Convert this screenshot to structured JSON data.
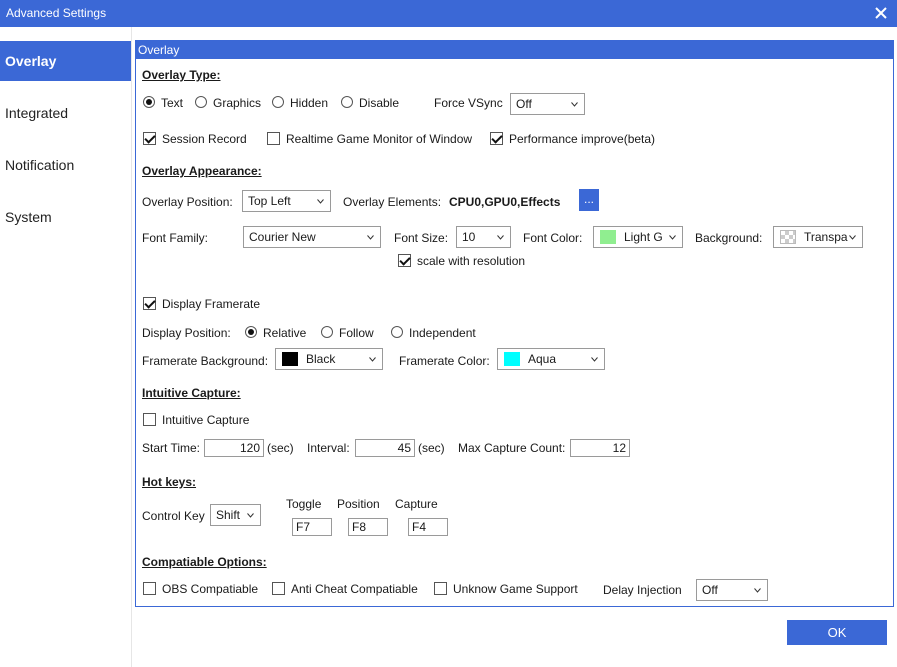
{
  "window": {
    "title": "Advanced Settings"
  },
  "sidebar": {
    "items": [
      {
        "label": "Overlay",
        "active": true
      },
      {
        "label": "Integrated"
      },
      {
        "label": "Notification"
      },
      {
        "label": "System"
      }
    ]
  },
  "panel": {
    "header": "Overlay"
  },
  "overlay_type": {
    "title": "Overlay Type:",
    "options": [
      "Text",
      "Graphics",
      "Hidden",
      "Disable"
    ],
    "selected": "Text",
    "force_vsync_label": "Force VSync",
    "force_vsync_value": "Off"
  },
  "options_row": {
    "session_record": {
      "label": "Session Record",
      "checked": true
    },
    "realtime_monitor": {
      "label": "Realtime Game Monitor of Window",
      "checked": false
    },
    "performance_improve": {
      "label": "Performance improve(beta)",
      "checked": true
    }
  },
  "appearance": {
    "title": "Overlay Appearance:",
    "position_label": "Overlay Position:",
    "position_value": "Top Left",
    "elements_label": "Overlay Elements:",
    "elements_value": "CPU0,GPU0,Effects",
    "elements_button": "...",
    "font_family_label": "Font Family:",
    "font_family_value": "Courier New",
    "font_size_label": "Font Size:",
    "font_size_value": "10",
    "font_color_label": "Font Color:",
    "font_color_value": "Light G",
    "font_color_swatch": "#90ee90",
    "background_label": "Background:",
    "background_value": "Transpa",
    "scale_label": "scale with resolution",
    "scale_checked": true
  },
  "framerate": {
    "display_label": "Display Framerate",
    "display_checked": true,
    "position_label": "Display Position:",
    "position_options": [
      "Relative",
      "Follow",
      "Independent"
    ],
    "position_selected": "Relative",
    "bg_label": "Framerate Background:",
    "bg_value": "Black",
    "bg_swatch": "#000000",
    "color_label": "Framerate Color:",
    "color_value": "Aqua",
    "color_swatch": "#00ffff"
  },
  "capture": {
    "title": "Intuitive Capture:",
    "enable_label": "Intuitive Capture",
    "enable_checked": false,
    "start_label": "Start Time:",
    "start_value": "120",
    "start_unit": "(sec)",
    "interval_label": "Interval:",
    "interval_value": "45",
    "interval_unit": "(sec)",
    "max_label": "Max Capture Count:",
    "max_value": "12"
  },
  "hotkeys": {
    "title": "Hot keys:",
    "control_label": "Control Key",
    "control_value": "Shift",
    "toggle_label": "Toggle",
    "toggle_value": "F7",
    "position_label": "Position",
    "position_value": "F8",
    "capture_label": "Capture",
    "capture_value": "F4"
  },
  "compat": {
    "title": "Compatiable Options:",
    "obs": {
      "label": "OBS Compatiable",
      "checked": false
    },
    "anticheat": {
      "label": "Anti Cheat Compatiable",
      "checked": false
    },
    "unknown": {
      "label": "Unknow Game Support",
      "checked": false
    },
    "delay_label": "Delay Injection",
    "delay_value": "Off"
  },
  "footer": {
    "ok_label": "OK"
  },
  "colors": {
    "accent": "#3b68d6"
  }
}
